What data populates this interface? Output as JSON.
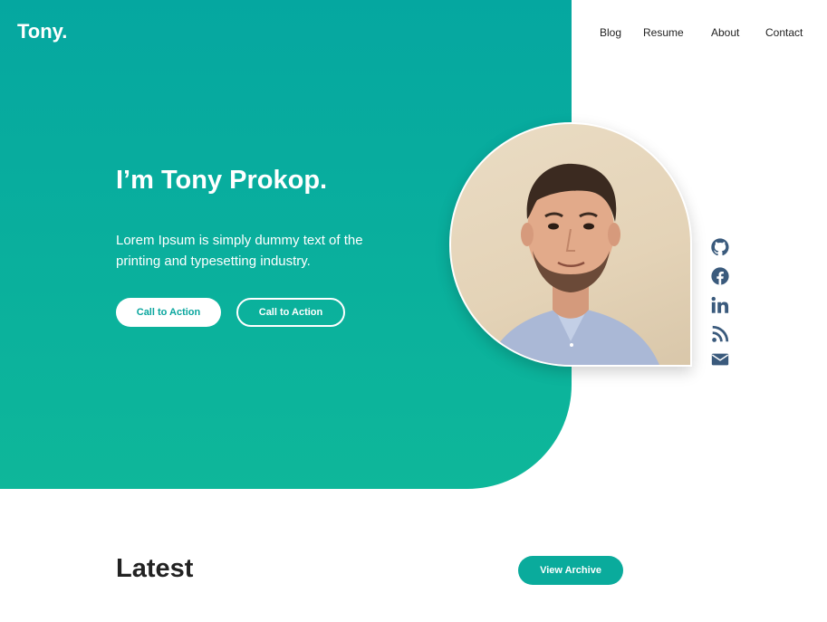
{
  "brand": {
    "logo": "Tony."
  },
  "nav": {
    "items": [
      "Blog",
      "Resume",
      "About",
      "Contact"
    ]
  },
  "hero": {
    "headline": "I’m Tony Prokop.",
    "subtext": "Lorem Ipsum is simply dummy text of the printing and typesetting industry.",
    "primary_button": "Call to Action",
    "secondary_button": "Call to Action"
  },
  "social": {
    "icons": [
      "github-icon",
      "facebook-icon",
      "linkedin-icon",
      "rss-icon",
      "email-icon"
    ],
    "color": "#3a5a7c"
  },
  "latest": {
    "heading": "Latest",
    "archive_button": "View Archive"
  },
  "colors": {
    "accent_gradient_top": "#05a7a0",
    "accent_gradient_bottom": "#0eb79a",
    "archive_button": "#0aab9c"
  }
}
